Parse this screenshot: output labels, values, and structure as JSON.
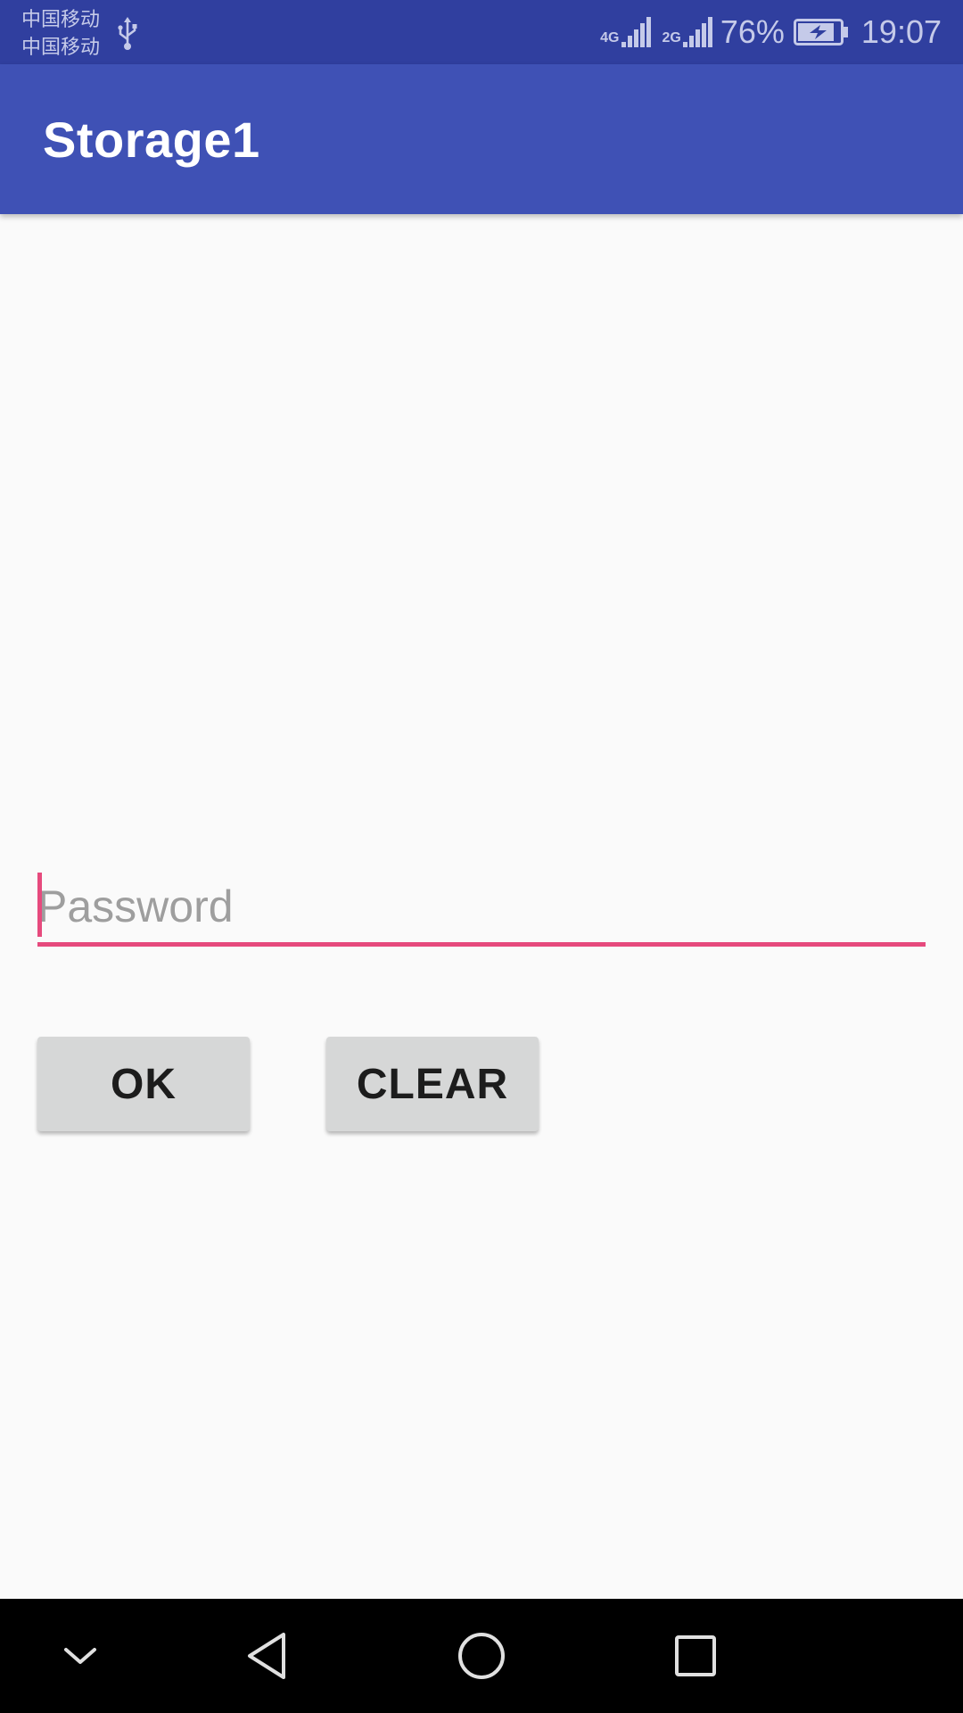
{
  "status_bar": {
    "carrier_1": "中国移动",
    "carrier_2": "中国移动",
    "network_1": "4G",
    "network_2": "2G",
    "battery": "76%",
    "time": "19:07",
    "icons": [
      "usb-icon",
      "signal-icon",
      "battery-charging-icon"
    ]
  },
  "app_bar": {
    "title": "Storage1"
  },
  "form": {
    "password_placeholder": "Password",
    "password_value": "",
    "ok_label": "OK",
    "clear_label": "CLEAR"
  },
  "nav_bar": {
    "icons": [
      "hide-keyboard-icon",
      "back-icon",
      "home-icon",
      "recents-icon"
    ]
  },
  "colors": {
    "status_bar": "#303f9f",
    "app_bar": "#3f51b5",
    "accent": "#e64a7d",
    "button": "#d6d7d7",
    "background": "#fafafa"
  }
}
